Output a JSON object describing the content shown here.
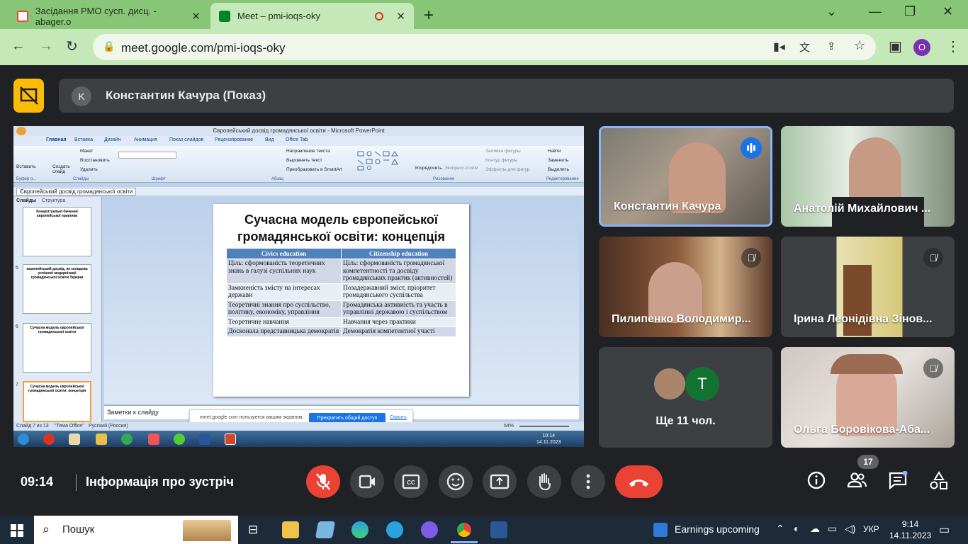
{
  "browser": {
    "tabs": [
      {
        "title": "Засідання РМО сусп. дисц. - abager.o"
      },
      {
        "title": "Meet – pmi-ioqs-oky"
      }
    ],
    "url": "meet.google.com/pmi-ioqs-oky",
    "profile_initial": "O"
  },
  "meet": {
    "presenter_initial": "K",
    "presenter_label": "Константин Качура (Показ)",
    "time": "09:14",
    "meeting_info": "Інформація про зустріч",
    "people_count": "17",
    "more_participants": "Ще 11 чол.",
    "more_avatar_letter": "T",
    "participants": [
      {
        "name": "Константин Качура"
      },
      {
        "name": "Анатолій Михайлович ..."
      },
      {
        "name": "Пилипенко Володимир..."
      },
      {
        "name": "Ірина Леонідівна Зінов..."
      },
      {
        "name": "Ольга Боровікова-Аба..."
      }
    ]
  },
  "powerpoint": {
    "title": "Європейський досвід громадянської освіти - Microsoft PowerPoint",
    "ribbon_tabs": [
      "Главная",
      "Вставка",
      "Дизайн",
      "Анимация",
      "Показ слайдов",
      "Рецензирование",
      "Вид",
      "Office Tab"
    ],
    "ribbon_items": {
      "paste": "Вставить",
      "create_slide": "Создать слайд",
      "layout": "Макет",
      "restore": "Восстановить",
      "delete": "Удалить",
      "text_direction": "Направление текста",
      "align_text": "Выровнять текст",
      "smartart": "Преобразовать в SmartArt",
      "arrange": "Упорядочить",
      "quick_styles": "Экспресс-стили",
      "shape_fill": "Заливка фигуры",
      "shape_outline": "Контур фигуры",
      "shape_effects": "Эффекты для фигур",
      "find": "Найти",
      "replace": "Заменить",
      "select": "Выделить"
    },
    "ribbon_groups": [
      "Буфер о...",
      "Слайды",
      "Шрифт",
      "Абзац",
      "Рисование",
      "Редактирование"
    ],
    "doc_tab": "Європейський досвід громадянської освіти",
    "panel_tabs": [
      "Слайды",
      "Структура"
    ],
    "thumbnails": [
      {
        "num": "",
        "title": "Концептуальні бачення європейської практики"
      },
      {
        "num": "5",
        "title": "європейський досвід, як складова успішної модернізації громадянської освіти України"
      },
      {
        "num": "6",
        "title": "Сучасна модель європейської громадянської освіти"
      },
      {
        "num": "7",
        "title": "Сучасна модель європейської громадянської освіти: концепція"
      }
    ],
    "slide": {
      "title": "Сучасна модель європейської громадянської освіти: концепція",
      "headers": [
        "Civics education",
        "Citizenship education"
      ],
      "rows": [
        [
          "Ціль: сформованість теоретичних знань в галузі суспільних наук",
          "Ціль: сформованість громадянської компетентності та досвіду громадянських практик (активностей)"
        ],
        [
          "Замкненість змісту на інтересах держави",
          "Позадержавний зміст, пріоритет громадянського суспільства"
        ],
        [
          "Теоретичні знання про суспільство, політику, економіку, управління",
          "Громадянська активність та участь в управлінні державою і суспільством"
        ],
        [
          "Теоретичне навчання",
          "Навчання через практики"
        ],
        [
          "Досконала представницька демократія",
          "Демократія компетентної участі"
        ]
      ]
    },
    "notes_placeholder": "Заметки к слайду",
    "share_banner": {
      "text": "meet.google.com пользуется вашим экраном.",
      "stop": "Прекратить общий доступ",
      "hide": "Скрыть"
    },
    "status": {
      "slide": "Слайд 7 из 13",
      "theme": "\"Тема Office\"",
      "language": "Русский (Россия)",
      "zoom": "64%"
    },
    "inner_clock": {
      "time": "10:14",
      "date": "14.11.2023"
    }
  },
  "taskbar": {
    "search": "Пошук",
    "weather": "Earnings upcoming",
    "language": "УКР",
    "time": "9:14",
    "date": "14.11.2023"
  },
  "colors": {
    "tabstrip": "#87c577",
    "toolbar": "#c5e8b9",
    "meet_bg": "#202124",
    "danger": "#ea4335",
    "accent": "#1a73e8"
  }
}
